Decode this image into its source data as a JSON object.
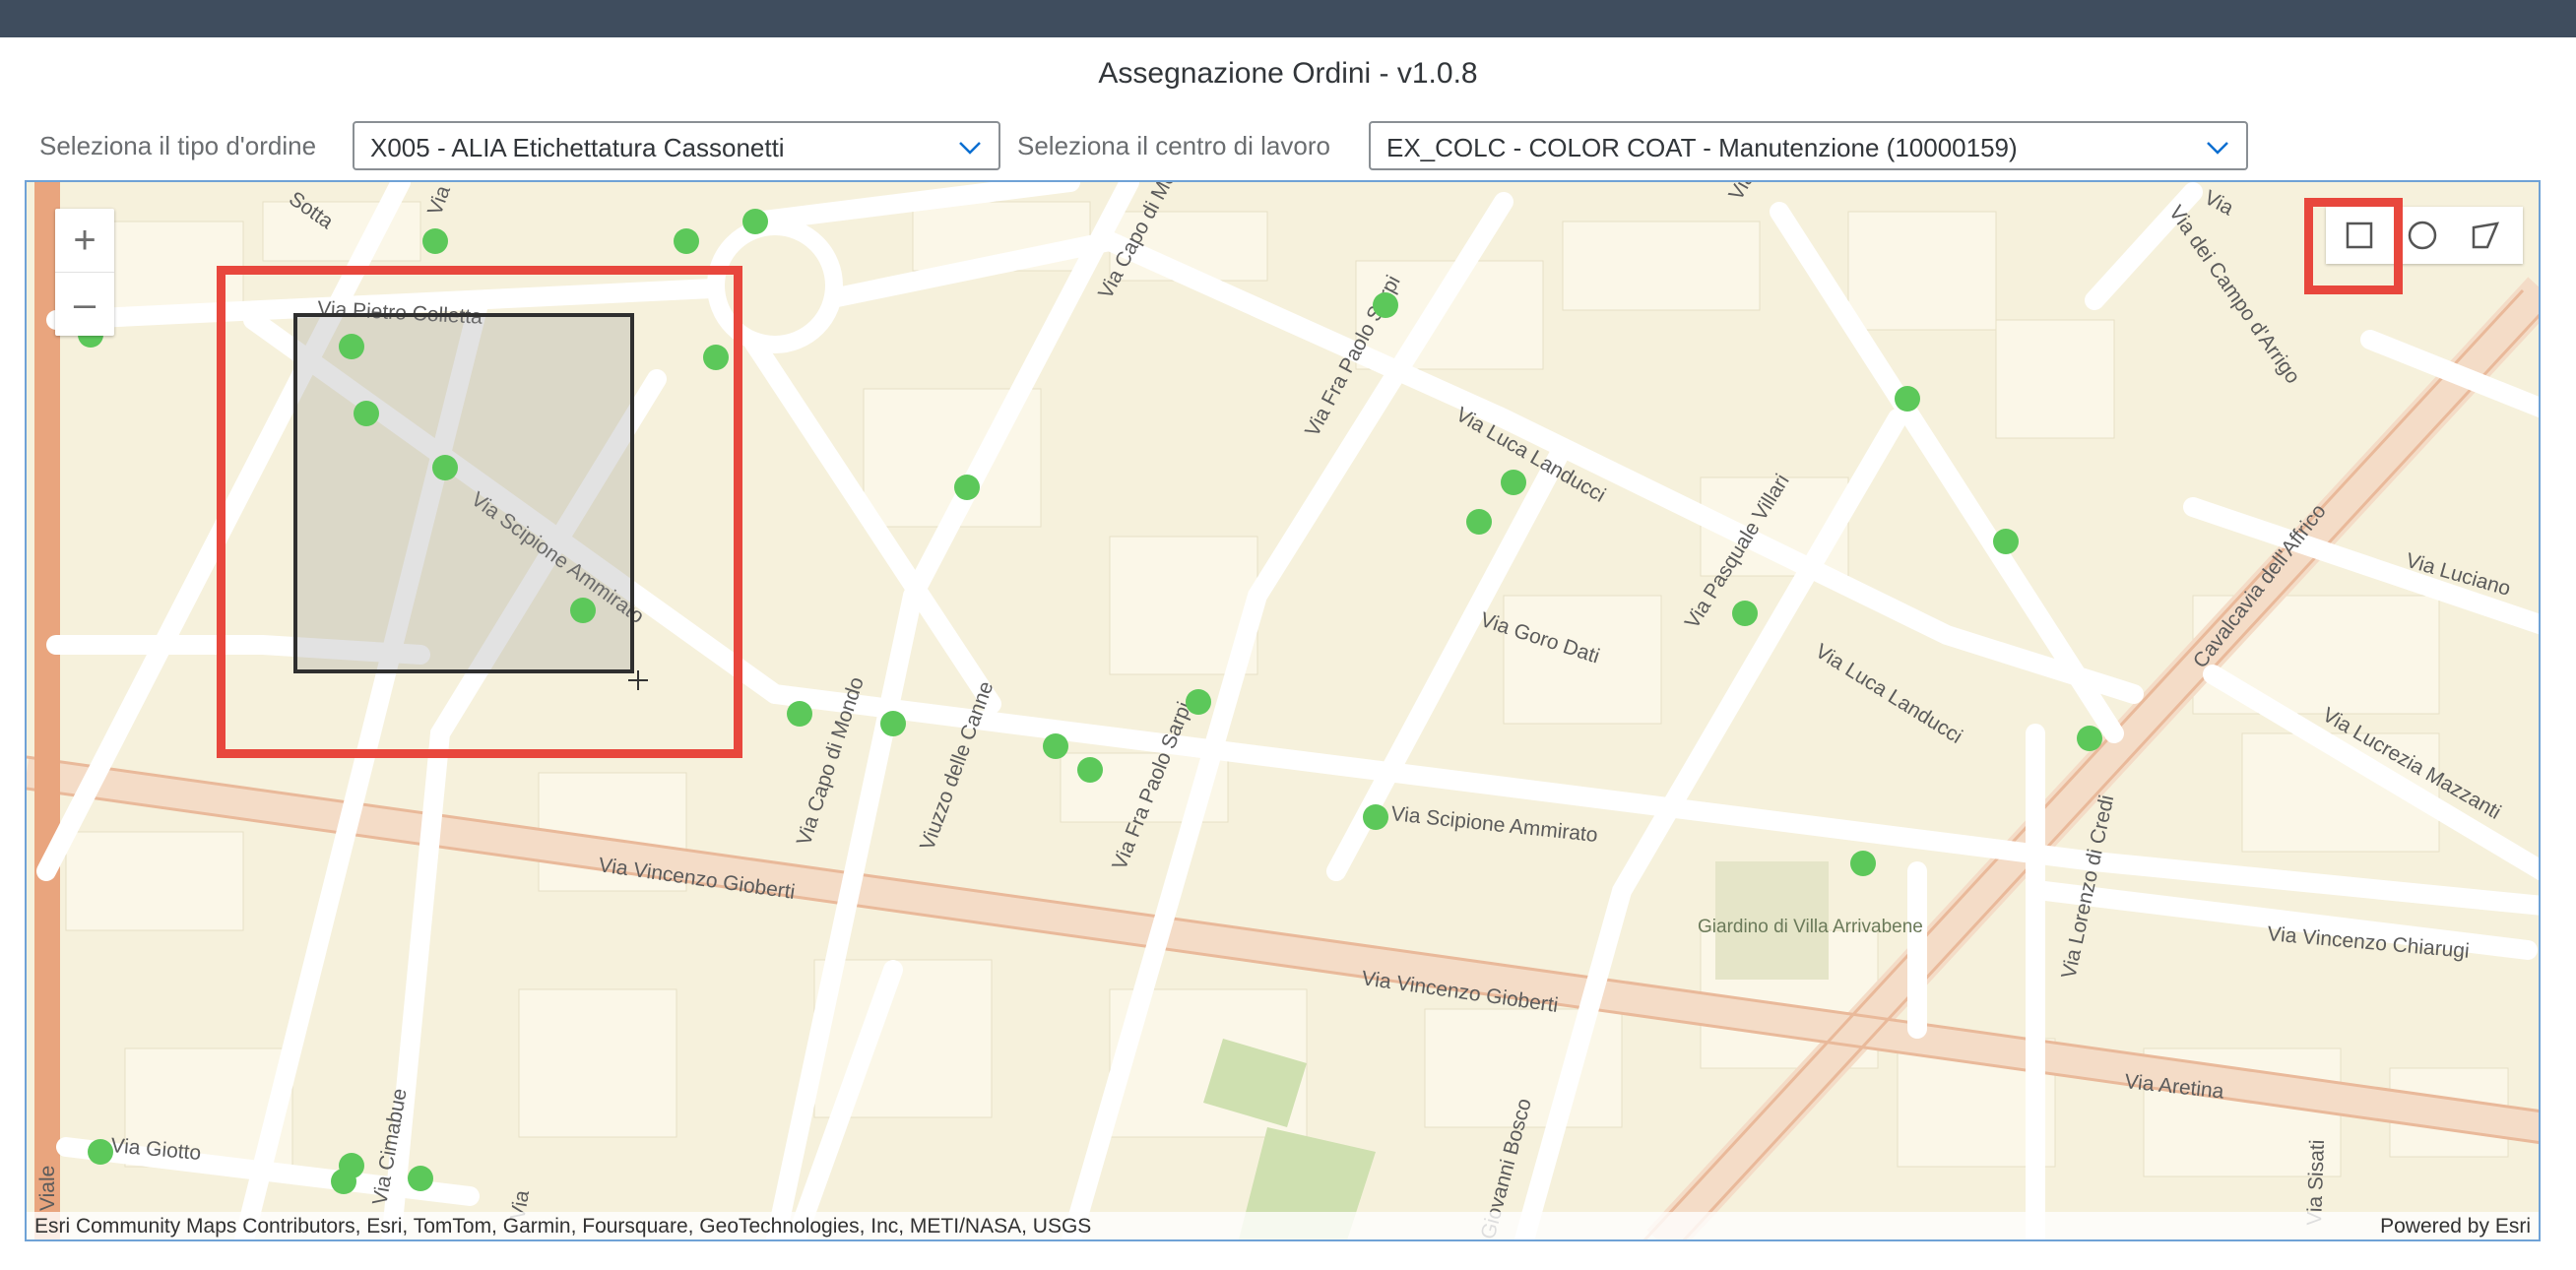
{
  "header": {
    "title": "Assegnazione Ordini - v1.0.8"
  },
  "filters": {
    "order_type_label": "Seleziona il tipo d'ordine",
    "order_type_value": "X005 - ALIA Etichettatura Cassonetti",
    "work_center_label": "Seleziona il centro di lavoro",
    "work_center_value": "EX_COLC - COLOR COAT - Manutenzione (10000159)"
  },
  "map": {
    "zoom_in": "+",
    "zoom_out": "–",
    "attribution": "Esri Community Maps Contributors, Esri, TomTom, Garmin, Foursquare, GeoTechnologies, Inc, METI/NASA, USGS",
    "powered_by": "Powered by Esri",
    "draw_tools": [
      {
        "icon": "rectangle-icon",
        "active": true
      },
      {
        "icon": "circle-icon",
        "active": false
      },
      {
        "icon": "polygon-icon",
        "active": false
      }
    ],
    "streets": {
      "s1": "Via Pietro Colletta",
      "s2": "Via Scipione Ammirato",
      "s3": "Via Capo di Mondo",
      "s4": "Viuzzo delle Canne",
      "s5": "Via Fra Paolo Sarpi",
      "s6": "Via Fra Paolo Sarpi",
      "s7": "Via Luca Landucci",
      "s8": "Via Goro Dati",
      "s9": "Via Pasquale Villari",
      "s10": "Via Luca Landucci",
      "s11": "Via Scipione Ammirato",
      "s12": "Via Vincenzo Gioberti",
      "s13": "Via Vincenzo Gioberti",
      "s14": "Cavalcavia dell'Affrico",
      "s15": "Via Lorenzo di Credi",
      "s16": "Via Vincenzo Chiarugi",
      "s17": "Via Aretina",
      "s18": "Via Luciano",
      "s19": "Via Lucrezia Mazzanti",
      "s20": "Via dei Campo d'Arrigo",
      "s21": "Via Cimabue",
      "s22": "Via Giotto",
      "s23": "Viale",
      "s24": "Via Capo di Mondo",
      "s25": "Giovanni Bosco",
      "s26": "Via Sisati",
      "s27": "Via",
      "s28": "Via",
      "s29": "Via",
      "s30": "Via",
      "s31": "Sotta",
      "park": "Giardino di Villa Arrivabene"
    },
    "point_color": "#5cc85a",
    "selection_highlight_color": "#e8473d"
  }
}
